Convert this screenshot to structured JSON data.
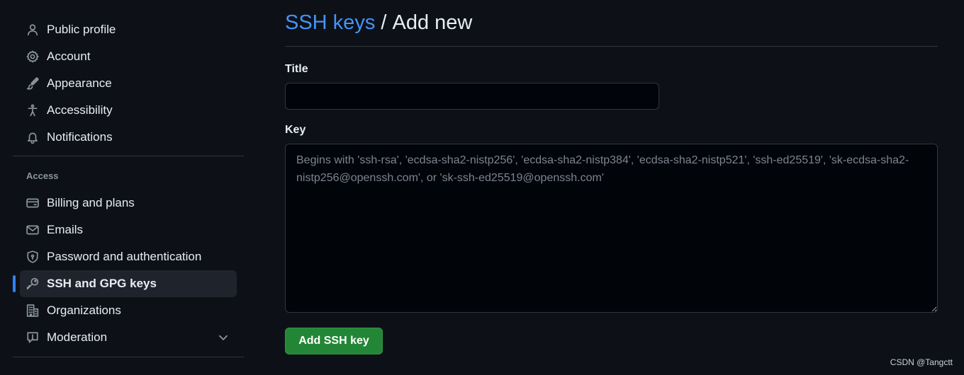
{
  "sidebar": {
    "top_items": [
      {
        "label": "Public profile",
        "icon": "person-icon"
      },
      {
        "label": "Account",
        "icon": "gear-icon"
      },
      {
        "label": "Appearance",
        "icon": "paintbrush-icon"
      },
      {
        "label": "Accessibility",
        "icon": "accessibility-icon"
      },
      {
        "label": "Notifications",
        "icon": "bell-icon"
      }
    ],
    "access_heading": "Access",
    "access_items": [
      {
        "label": "Billing and plans",
        "icon": "credit-card-icon"
      },
      {
        "label": "Emails",
        "icon": "mail-icon"
      },
      {
        "label": "Password and authentication",
        "icon": "shield-lock-icon"
      },
      {
        "label": "SSH and GPG keys",
        "icon": "key-icon",
        "active": true
      },
      {
        "label": "Organizations",
        "icon": "organization-icon"
      },
      {
        "label": "Moderation",
        "icon": "report-icon",
        "expandable": true
      }
    ]
  },
  "main": {
    "breadcrumb_link": "SSH keys",
    "breadcrumb_separator": "/",
    "breadcrumb_current": "Add new",
    "title_label": "Title",
    "title_value": "",
    "key_label": "Key",
    "key_placeholder": "Begins with 'ssh-rsa', 'ecdsa-sha2-nistp256', 'ecdsa-sha2-nistp384', 'ecdsa-sha2-nistp521', 'ssh-ed25519', 'sk-ecdsa-sha2-nistp256@openssh.com', or 'sk-ssh-ed25519@openssh.com'",
    "submit_label": "Add SSH key"
  },
  "watermark": "CSDN @Tangctt",
  "colors": {
    "background": "#0d1117",
    "accent": "#2f81f7",
    "link": "#4493f8",
    "primary_button": "#238636"
  }
}
